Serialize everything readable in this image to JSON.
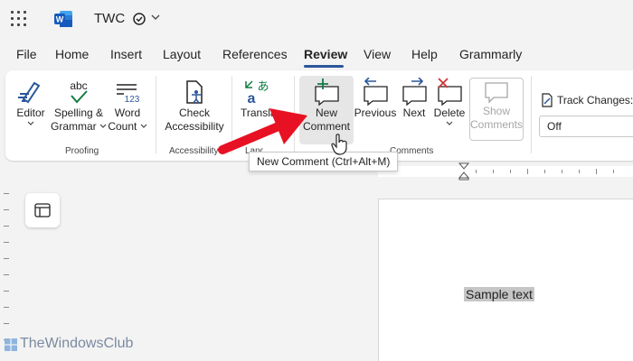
{
  "titlebar": {
    "title": "TWC"
  },
  "tabs": [
    {
      "label": "File"
    },
    {
      "label": "Home"
    },
    {
      "label": "Insert"
    },
    {
      "label": "Layout"
    },
    {
      "label": "References"
    },
    {
      "label": "Review"
    },
    {
      "label": "View"
    },
    {
      "label": "Help"
    },
    {
      "label": "Grammarly"
    }
  ],
  "ribbon": {
    "proofing": {
      "editor_label": "Editor",
      "spelling_line1": "Spelling &",
      "spelling_line2": "Grammar",
      "wordcount_line1": "Word",
      "wordcount_line2": "Count",
      "abc_glyph": "abc",
      "count_glyph": "123",
      "group_label": "Proofing"
    },
    "accessibility": {
      "check_line1": "Check",
      "check_line2": "Accessibility",
      "group_label": "Accessibility"
    },
    "language": {
      "translate_label": "Translate",
      "group_label": "Language",
      "glyph_a": "a",
      "glyph_kana": "あ"
    },
    "comments": {
      "new_line1": "New",
      "new_line2": "Comment",
      "previous_label": "Previous",
      "next_label": "Next",
      "delete_label": "Delete",
      "show_line1": "Show",
      "show_line2": "Comments",
      "group_label": "Comments"
    },
    "tracking": {
      "track_label": "Track Changes:",
      "track_value": "Off"
    }
  },
  "tooltip": {
    "text": "New Comment (Ctrl+Alt+M)"
  },
  "document": {
    "sample_text": "Sample text"
  },
  "watermark": {
    "text": "TheWindowsClub"
  },
  "colors": {
    "word_blue": "#2b579a",
    "accent_green": "#107c41",
    "delete_red": "#d13438",
    "arrow_red": "#e81123"
  }
}
